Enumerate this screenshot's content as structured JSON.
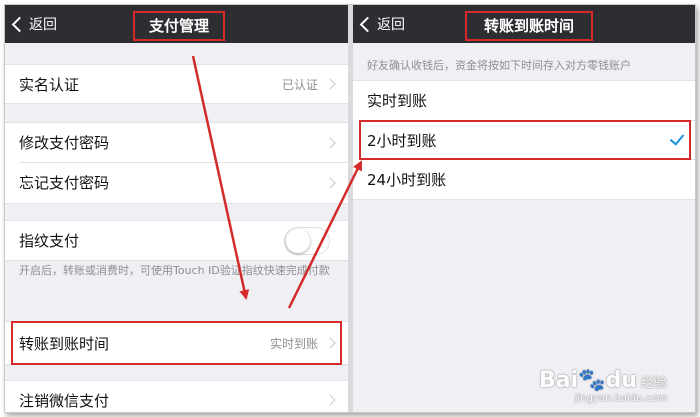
{
  "left": {
    "back_label": "返回",
    "title": "支付管理",
    "items": {
      "realname": {
        "label": "实名认证",
        "value": "已认证"
      },
      "change_pwd": {
        "label": "修改支付密码"
      },
      "forgot_pwd": {
        "label": "忘记支付密码"
      },
      "fingerprint": {
        "label": "指纹支付",
        "hint": "开启后，转账或消费时，可使用Touch ID验证指纹快速完成付款",
        "enabled": false
      },
      "transfer_time": {
        "label": "转账到账时间",
        "value": "实时到账"
      },
      "cancel_wechat": {
        "label": "注销微信支付"
      }
    }
  },
  "right": {
    "back_label": "返回",
    "title": "转账到账时间",
    "hint": "好友确认收钱后，资金将按如下时间存入对方零钱账户",
    "options": [
      {
        "label": "实时到账",
        "selected": false
      },
      {
        "label": "2小时到账",
        "selected": true
      },
      {
        "label": "24小时到账",
        "selected": false
      }
    ]
  },
  "watermark": {
    "brand": "Bai",
    "paw": "du",
    "suffix": "经验",
    "domain": "jingyan.baidu.com"
  },
  "colors": {
    "navbar": "#2d2d32",
    "highlight": "#d42a2a",
    "check": "#1a8fe3",
    "background": "#efeff4"
  }
}
